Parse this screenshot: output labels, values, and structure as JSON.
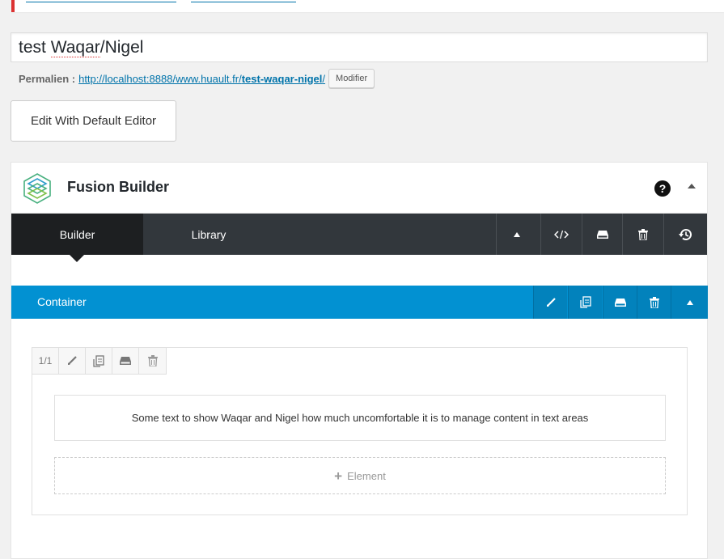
{
  "post": {
    "title_part1": "test ",
    "title_part2": "Waqar",
    "title_part3": "/Nigel"
  },
  "permalink": {
    "label": "Permalien :",
    "url_base": "http://localhost:8888/www.huault.fr/",
    "slug": "test-waqar-nigel",
    "url_end": "/",
    "modify_button": "Modifier"
  },
  "default_editor_button": "Edit With Default Editor",
  "fusion_builder": {
    "title": "Fusion Builder",
    "help": "?",
    "tabs": [
      {
        "label": "Builder",
        "active": true
      },
      {
        "label": "Library",
        "active": false
      }
    ],
    "toolbar_icons": [
      "collapse-icon",
      "code-icon",
      "save-icon",
      "trash-icon",
      "history-icon"
    ],
    "container": {
      "label": "Container",
      "icons": [
        "brush-icon",
        "clone-icon",
        "save-icon",
        "trash-icon",
        "collapse-icon"
      ]
    },
    "column": {
      "size": "1/1",
      "icons": [
        "brush-icon",
        "clone-icon",
        "save-icon",
        "trash-icon"
      ],
      "text_element": "Some text to show Waqar and Nigel how much uncomfortable it is to manage content in text areas",
      "add_element": "Element"
    }
  },
  "colors": {
    "nav_bg": "#32373c",
    "active_tab": "#1d1f21",
    "container_bar": "#0291d2",
    "link": "#0073aa",
    "notice_border": "#dc3232"
  }
}
